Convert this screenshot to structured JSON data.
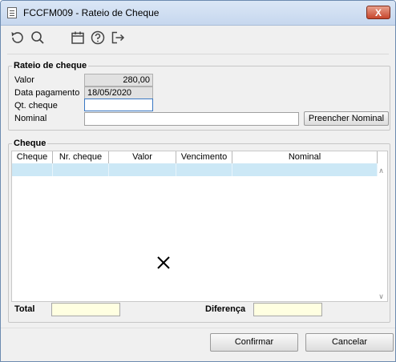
{
  "window": {
    "title": "FCCFM009 - Rateio de Cheque",
    "close_label": "X"
  },
  "toolbar": {
    "icons": [
      "refresh-icon",
      "search-icon",
      "calendar-icon",
      "help-icon",
      "exit-icon"
    ]
  },
  "rateio": {
    "legend": "Rateio de cheque",
    "valor_label": "Valor",
    "valor_value": "280,00",
    "data_label": "Data pagamento",
    "data_value": "18/05/2020",
    "qt_label": "Qt. cheque",
    "qt_value": "",
    "nominal_label": "Nominal",
    "nominal_value": "",
    "preencher_label": "Preencher Nominal"
  },
  "cheque": {
    "legend": "Cheque",
    "columns": [
      "Cheque",
      "Nr. cheque",
      "Valor",
      "Vencimento",
      "Nominal"
    ],
    "total_label": "Total",
    "total_value": "",
    "diferenca_label": "Diferença",
    "diferenca_value": ""
  },
  "actions": {
    "confirm_label": "Confirmar",
    "cancel_label": "Cancelar"
  },
  "colors": {
    "accent": "#3a78c3",
    "selection": "#cce8f6",
    "readonly": "#e1e1e1",
    "total_bg": "#ffffe1"
  }
}
